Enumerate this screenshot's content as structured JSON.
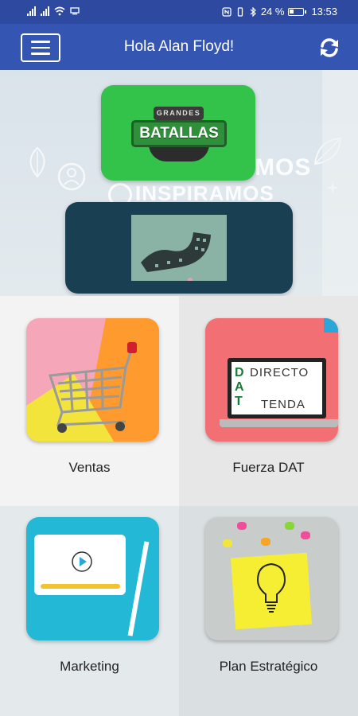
{
  "status_bar": {
    "battery_percent": "24 %",
    "time": "13:53"
  },
  "header": {
    "title": "Hola Alan Floyd!"
  },
  "hero": {
    "background_text_1": "MOS",
    "background_text_2": "INSPIRAMOS",
    "batallas_badge_top": "GRANDES",
    "batallas_badge_main": "BATALLAS"
  },
  "tiles": [
    {
      "label": "Ventas"
    },
    {
      "label": "Fuerza DAT",
      "screen_text_1": "DIRECTO",
      "screen_text_2": "TENDA",
      "logo_letters": "DAT"
    },
    {
      "label": "Marketing"
    },
    {
      "label": "Plan Estratégico"
    }
  ],
  "colors": {
    "status_bar": "#2d4aa0",
    "header": "#3455b2",
    "batallas_green": "#33c24a",
    "video_card": "#183f52"
  },
  "icons": [
    "menu-icon",
    "refresh-icon",
    "play-icon",
    "shopping-cart-icon",
    "lightbulb-icon",
    "film-reel-icon"
  ]
}
